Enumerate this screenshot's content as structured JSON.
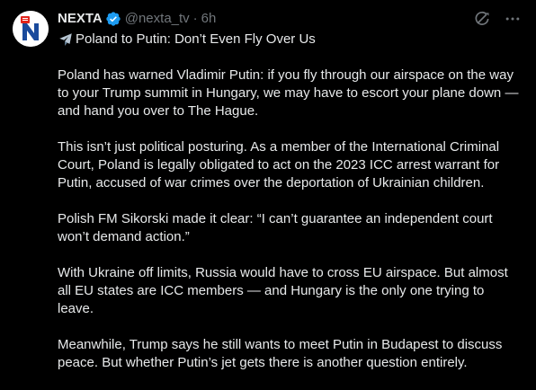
{
  "author": {
    "display_name": "NEXTA",
    "handle": "@nexta_tv",
    "separator": "·",
    "time": "6h",
    "verified_icon": "verified-badge-icon",
    "avatar_icon": "nexta-logo-icon"
  },
  "actions": {
    "grok_icon": "grok-icon",
    "more_icon": "more-icon"
  },
  "tweet": {
    "title_icon": "airplane-icon",
    "title": "Poland to Putin: Don’t Even Fly Over Us",
    "paragraphs": [
      "Poland has warned Vladimir Putin: if you fly through our airspace on the way to your Trump summit in Hungary, we may have to escort your plane down — and hand you over to The Hague.",
      "This isn’t just political posturing. As a member of the International Criminal Court, Poland is legally obligated to act on the 2023 ICC arrest warrant for Putin, accused of war crimes over the deportation of Ukrainian children.",
      "Polish FM Sikorski made it clear: “I can’t guarantee an independent court won’t demand action.”",
      "With Ukraine off limits, Russia would have to cross EU airspace. But almost all EU states are ICC members — and Hungary is the only one trying to leave.",
      "Meanwhile, Trump says he still wants to meet Putin in Budapest to discuss peace. But whether Putin’s jet gets there is another question entirely."
    ]
  },
  "colors": {
    "background": "#000000",
    "text": "#e7e9ea",
    "muted": "#71767b",
    "verified": "#1d9bf0",
    "logo_red": "#e2241b",
    "logo_blue": "#1a4a9c"
  }
}
